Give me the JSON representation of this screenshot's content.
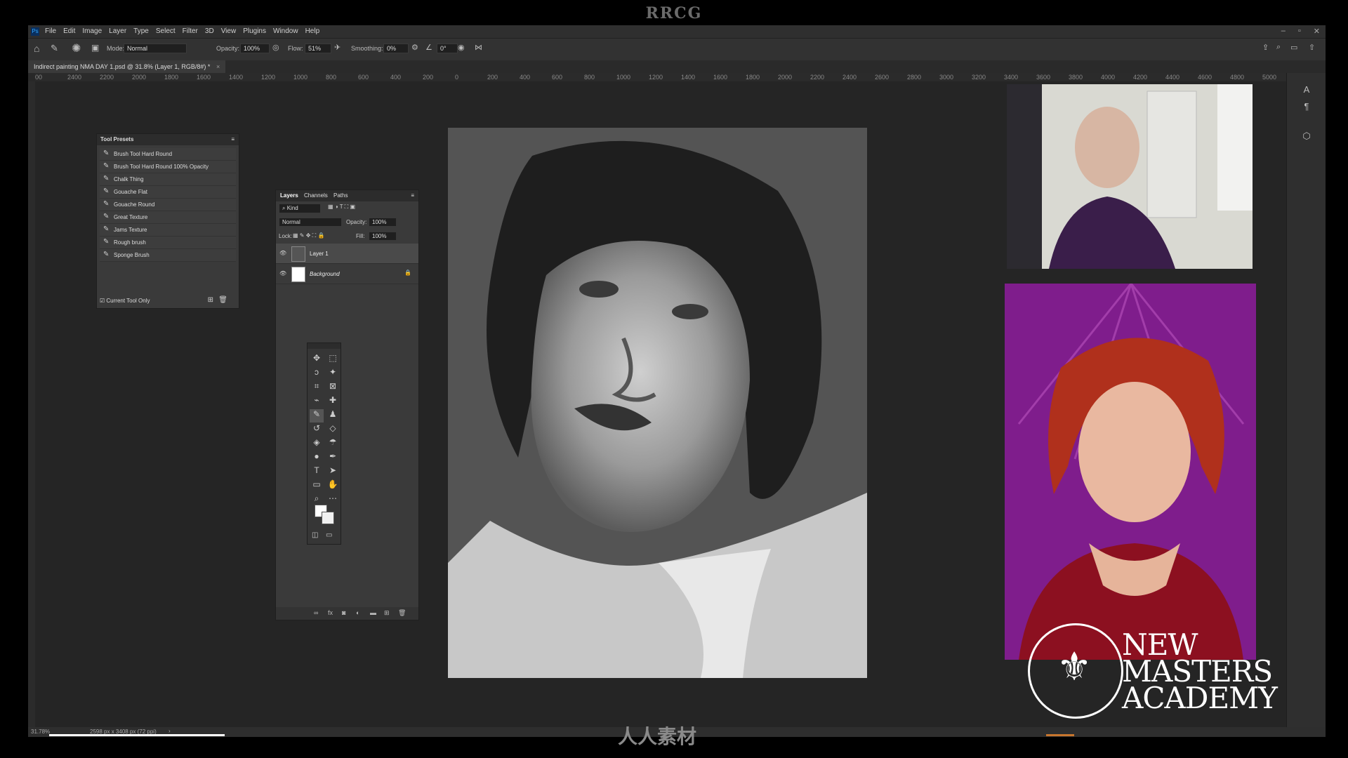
{
  "banner": {
    "title": "RRCG"
  },
  "menu": {
    "logo": "Ps",
    "items": [
      "File",
      "Edit",
      "Image",
      "Layer",
      "Type",
      "Select",
      "Filter",
      "3D",
      "View",
      "Plugins",
      "Window",
      "Help"
    ]
  },
  "window_controls": {
    "minimize": "–",
    "restore": "▫",
    "close": "✕"
  },
  "options": {
    "mode_label": "Mode:",
    "mode_value": "Normal",
    "opacity_label": "Opacity:",
    "opacity_value": "100%",
    "flow_label": "Flow:",
    "flow_value": "51%",
    "smoothing_label": "Smoothing:",
    "smoothing_value": "0%",
    "angle_value": "0°"
  },
  "document": {
    "tab_title": "Indirect painting NMA DAY 1.psd @ 31.8% (Layer 1, RGB/8#) *"
  },
  "ruler_ticks": [
    "00",
    "2400",
    "2200",
    "2000",
    "1800",
    "1600",
    "1400",
    "1200",
    "1000",
    "800",
    "600",
    "400",
    "200",
    "0",
    "200",
    "400",
    "600",
    "800",
    "1000",
    "1200",
    "1400",
    "1600",
    "1800",
    "2000",
    "2200",
    "2400",
    "2600",
    "2800",
    "3000",
    "3200",
    "3400",
    "3600",
    "3800",
    "4000",
    "4200",
    "4400",
    "4600",
    "4800",
    "5000"
  ],
  "tool_presets": {
    "title": "Tool Presets",
    "items": [
      "Brush Tool Hard Round",
      "Brush Tool Hard Round 100% Opacity",
      "Chalk Thing",
      "Gouache Flat",
      "Gouache Round",
      "Great Texture",
      "Jams Texture",
      "Rough brush",
      "Sponge Brush"
    ],
    "footer_checkbox": "Current Tool Only"
  },
  "layers_panel": {
    "tabs": [
      "Layers",
      "Channels",
      "Paths"
    ],
    "filter_label": "Kind",
    "blend_mode": "Normal",
    "opacity_label": "Opacity:",
    "opacity_value": "100%",
    "lock_label": "Lock:",
    "fill_label": "Fill:",
    "fill_value": "100%",
    "layers": [
      {
        "name": "Layer 1",
        "selected": true
      },
      {
        "name": "Background",
        "selected": false,
        "locked": true
      }
    ]
  },
  "status": {
    "zoom": "31.78%",
    "doc_size": "2598 px x 3408 px (72 ppi)",
    "arrow": "›"
  },
  "branding": {
    "line1": "NEW",
    "line2": "MASTERS",
    "line3": "ACADEMY"
  },
  "bottom_watermark": "人人素材",
  "colors": {
    "accent": "#31a8ff",
    "panel": "#3a3a3a",
    "canvas": "#252525",
    "ref_bg": "#7d1f8a"
  }
}
